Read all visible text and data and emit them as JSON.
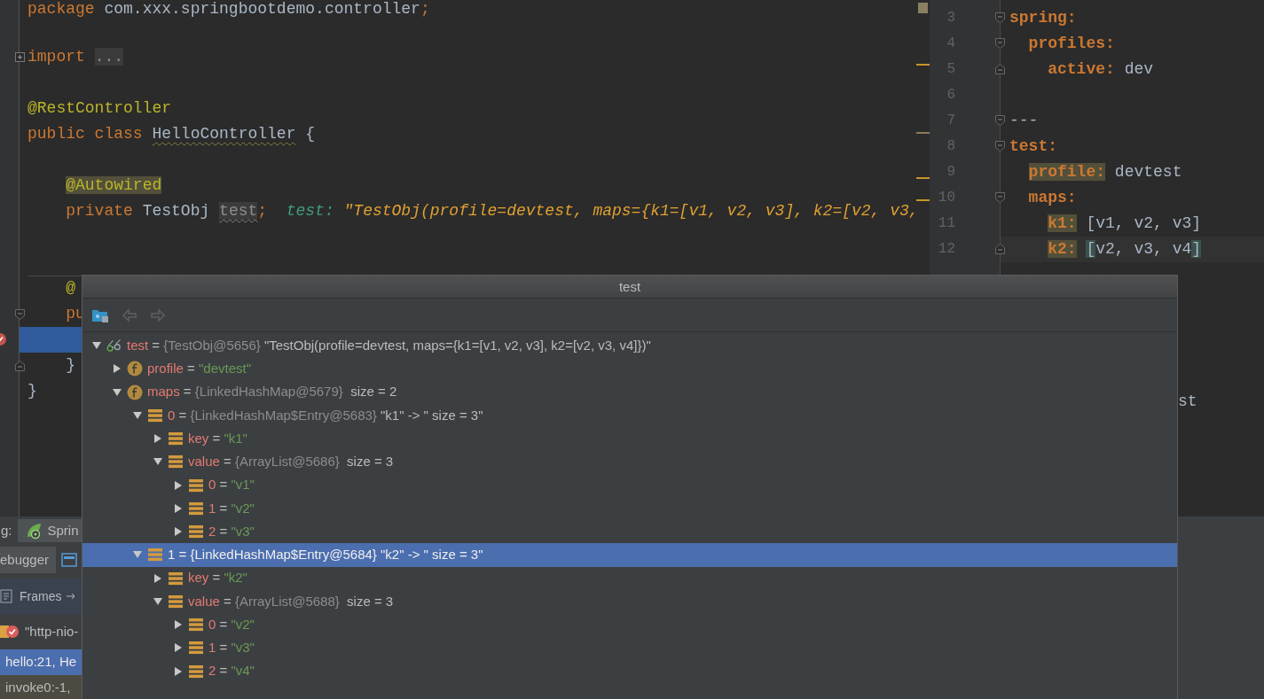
{
  "java_editor": {
    "lines": [
      {
        "kind": "code",
        "segments": [
          {
            "kind": "keyword",
            "text": "package"
          },
          {
            "kind": "plain",
            "text": " com.xxx.springbootdemo.controller"
          },
          {
            "kind": "keyword",
            "text": ";"
          }
        ]
      },
      {
        "kind": "blank"
      },
      {
        "kind": "folded",
        "segments": [
          {
            "kind": "keyword",
            "text": "import"
          },
          {
            "kind": "folded",
            "text": " ..."
          }
        ]
      },
      {
        "kind": "blank"
      },
      {
        "kind": "code",
        "segments": [
          {
            "kind": "annotation",
            "text": "@RestController"
          }
        ]
      },
      {
        "kind": "code",
        "segments": [
          {
            "kind": "keyword",
            "text": "public class"
          },
          {
            "kind": "warn",
            "text": " HelloController"
          },
          {
            "kind": "plain",
            "text": " {"
          }
        ]
      },
      {
        "kind": "blank"
      },
      {
        "kind": "code",
        "segments": [
          {
            "kind": "annotation-hl",
            "text": "    @Autowired"
          }
        ]
      },
      {
        "kind": "code",
        "segments": [
          {
            "kind": "keyword",
            "text": "    private"
          },
          {
            "kind": "plain",
            "text": " TestObj "
          },
          {
            "kind": "unused",
            "text": "test"
          },
          {
            "kind": "keyword",
            "text": ";"
          },
          {
            "kind": "hint-name",
            "text": "  test: "
          },
          {
            "kind": "hint-value",
            "text": "\"TestObj(profile=devtest, maps={k1=[v1, v2, v3], k2=[v2, v3,"
          }
        ]
      },
      {
        "kind": "blank"
      },
      {
        "kind": "blank"
      },
      {
        "kind": "code",
        "separator_above": true,
        "segments": [
          {
            "kind": "annotation",
            "text": "    @"
          }
        ]
      },
      {
        "kind": "fold-start",
        "segments": [
          {
            "kind": "keyword",
            "text": "    pu"
          }
        ]
      },
      {
        "kind": "blank",
        "highlighted": true,
        "breakpoint": true
      },
      {
        "kind": "fold-end",
        "segments": [
          {
            "kind": "plain",
            "text": "    }"
          }
        ]
      },
      {
        "kind": "code",
        "segments": [
          {
            "kind": "plain",
            "text": "}"
          }
        ]
      }
    ]
  },
  "yaml_editor": {
    "lines": [
      {
        "number": "3",
        "kind": "fold-start",
        "segments": [
          {
            "kind": "key",
            "text": "spring:"
          }
        ]
      },
      {
        "number": "4",
        "kind": "fold-start",
        "segments": [
          {
            "kind": "key",
            "text": "  profiles:"
          }
        ]
      },
      {
        "number": "5",
        "kind": "fold-end",
        "segments": [
          {
            "kind": "key",
            "text": "    active:"
          },
          {
            "kind": "plain",
            "text": " dev"
          }
        ]
      },
      {
        "number": "6",
        "kind": "blank"
      },
      {
        "number": "7",
        "kind": "fold-start",
        "segments": [
          {
            "kind": "plain",
            "text": "---"
          }
        ]
      },
      {
        "number": "8",
        "kind": "fold-start",
        "segments": [
          {
            "kind": "key",
            "text": "test:"
          }
        ]
      },
      {
        "number": "9",
        "kind": "code",
        "segments": [
          {
            "kind": "key-hl",
            "text": "  profile:"
          },
          {
            "kind": "plain",
            "text": " devtest"
          }
        ]
      },
      {
        "number": "10",
        "kind": "fold-start",
        "segments": [
          {
            "kind": "key",
            "text": "  maps:"
          }
        ]
      },
      {
        "number": "11",
        "kind": "code",
        "segments": [
          {
            "kind": "key-hl",
            "text": "    k1:"
          },
          {
            "kind": "plain",
            "text": " [v1, v2, v3]"
          }
        ]
      },
      {
        "number": "12",
        "kind": "fold-end",
        "current": true,
        "segments": [
          {
            "kind": "key-hl",
            "text": "    k2:"
          },
          {
            "kind": "bracket",
            "text": " ["
          },
          {
            "kind": "plain",
            "text": "v2, v3, v4"
          },
          {
            "kind": "bracket",
            "text": "]"
          }
        ]
      }
    ],
    "fragment": "st"
  },
  "debug_panel": {
    "label": "g:",
    "run_tabs": [
      {
        "label": "Sprin",
        "selected": true
      }
    ],
    "tool_tabs": [
      {
        "label": "ebugger",
        "selected": true
      }
    ],
    "frames_label": "Frames",
    "thread": "\"http-nio-",
    "frames": [
      {
        "label": "hello:21, He",
        "selected": true
      },
      {
        "label": "invoke0:-1,",
        "selected": false
      }
    ]
  },
  "popup": {
    "title": "test",
    "toolbar": [
      {
        "kind": "folder",
        "disabled": false
      },
      {
        "kind": "back",
        "disabled": true
      },
      {
        "kind": "forward",
        "disabled": true
      }
    ],
    "tree": [
      {
        "kind": "watch",
        "expanded": true,
        "selected": false,
        "segments": [
          {
            "kind": "name",
            "text": "test"
          },
          {
            "kind": "op",
            "text": " = "
          },
          {
            "kind": "type",
            "text": "{TestObj@5656}"
          },
          {
            "kind": "text",
            "text": " \"TestObj(profile=devtest, maps={k1=[v1, v2, v3], k2=[v2, v3, v4]})\""
          }
        ],
        "children": [
          {
            "kind": "field",
            "expanded": false,
            "selected": false,
            "segments": [
              {
                "kind": "name",
                "text": "profile"
              },
              {
                "kind": "op",
                "text": " = "
              },
              {
                "kind": "string",
                "text": "\"devtest\""
              }
            ]
          },
          {
            "kind": "field",
            "expanded": true,
            "selected": false,
            "segments": [
              {
                "kind": "name",
                "text": "maps"
              },
              {
                "kind": "op",
                "text": " = "
              },
              {
                "kind": "type",
                "text": "{LinkedHashMap@5679}"
              },
              {
                "kind": "text",
                "text": "  size = 2"
              }
            ],
            "children": [
              {
                "kind": "item",
                "expanded": true,
                "selected": false,
                "segments": [
                  {
                    "kind": "name",
                    "text": "0"
                  },
                  {
                    "kind": "op",
                    "text": " = "
                  },
                  {
                    "kind": "type",
                    "text": "{LinkedHashMap$Entry@5683}"
                  },
                  {
                    "kind": "text",
                    "text": " \"k1\" -> \" size = 3\""
                  }
                ],
                "children": [
                  {
                    "kind": "item",
                    "expanded": false,
                    "selected": false,
                    "segments": [
                      {
                        "kind": "name",
                        "text": "key"
                      },
                      {
                        "kind": "op",
                        "text": " = "
                      },
                      {
                        "kind": "string",
                        "text": "\"k1\""
                      }
                    ]
                  },
                  {
                    "kind": "item",
                    "expanded": true,
                    "selected": false,
                    "segments": [
                      {
                        "kind": "name",
                        "text": "value"
                      },
                      {
                        "kind": "op",
                        "text": " = "
                      },
                      {
                        "kind": "type",
                        "text": "{ArrayList@5686}"
                      },
                      {
                        "kind": "text",
                        "text": "  size = 3"
                      }
                    ],
                    "children": [
                      {
                        "kind": "item",
                        "expanded": false,
                        "selected": false,
                        "segments": [
                          {
                            "kind": "name",
                            "text": "0"
                          },
                          {
                            "kind": "op",
                            "text": " = "
                          },
                          {
                            "kind": "string",
                            "text": "\"v1\""
                          }
                        ]
                      },
                      {
                        "kind": "item",
                        "expanded": false,
                        "selected": false,
                        "segments": [
                          {
                            "kind": "name",
                            "text": "1"
                          },
                          {
                            "kind": "op",
                            "text": " = "
                          },
                          {
                            "kind": "string",
                            "text": "\"v2\""
                          }
                        ]
                      },
                      {
                        "kind": "item",
                        "expanded": false,
                        "selected": false,
                        "segments": [
                          {
                            "kind": "name",
                            "text": "2"
                          },
                          {
                            "kind": "op",
                            "text": " = "
                          },
                          {
                            "kind": "string",
                            "text": "\"v3\""
                          }
                        ]
                      }
                    ]
                  }
                ]
              },
              {
                "kind": "item",
                "expanded": true,
                "selected": true,
                "segments": [
                  {
                    "kind": "name",
                    "text": "1"
                  },
                  {
                    "kind": "op",
                    "text": " = "
                  },
                  {
                    "kind": "type",
                    "text": "{LinkedHashMap$Entry@5684}"
                  },
                  {
                    "kind": "text",
                    "text": " \"k2\" -> \" size = 3\""
                  }
                ],
                "children": [
                  {
                    "kind": "item",
                    "expanded": false,
                    "selected": false,
                    "segments": [
                      {
                        "kind": "name",
                        "text": "key"
                      },
                      {
                        "kind": "op",
                        "text": " = "
                      },
                      {
                        "kind": "string",
                        "text": "\"k2\""
                      }
                    ]
                  },
                  {
                    "kind": "item",
                    "expanded": true,
                    "selected": false,
                    "segments": [
                      {
                        "kind": "name",
                        "text": "value"
                      },
                      {
                        "kind": "op",
                        "text": " = "
                      },
                      {
                        "kind": "type",
                        "text": "{ArrayList@5688}"
                      },
                      {
                        "kind": "text",
                        "text": "  size = 3"
                      }
                    ],
                    "children": [
                      {
                        "kind": "item",
                        "expanded": false,
                        "selected": false,
                        "segments": [
                          {
                            "kind": "name",
                            "text": "0"
                          },
                          {
                            "kind": "op",
                            "text": " = "
                          },
                          {
                            "kind": "string",
                            "text": "\"v2\""
                          }
                        ]
                      },
                      {
                        "kind": "item",
                        "expanded": false,
                        "selected": false,
                        "segments": [
                          {
                            "kind": "name",
                            "text": "1"
                          },
                          {
                            "kind": "op",
                            "text": " = "
                          },
                          {
                            "kind": "string",
                            "text": "\"v3\""
                          }
                        ]
                      },
                      {
                        "kind": "item",
                        "expanded": false,
                        "selected": false,
                        "segments": [
                          {
                            "kind": "name",
                            "text": "2"
                          },
                          {
                            "kind": "op",
                            "text": " = "
                          },
                          {
                            "kind": "string",
                            "text": "\"v4\""
                          }
                        ]
                      }
                    ]
                  }
                ]
              }
            ]
          }
        ]
      }
    ]
  }
}
